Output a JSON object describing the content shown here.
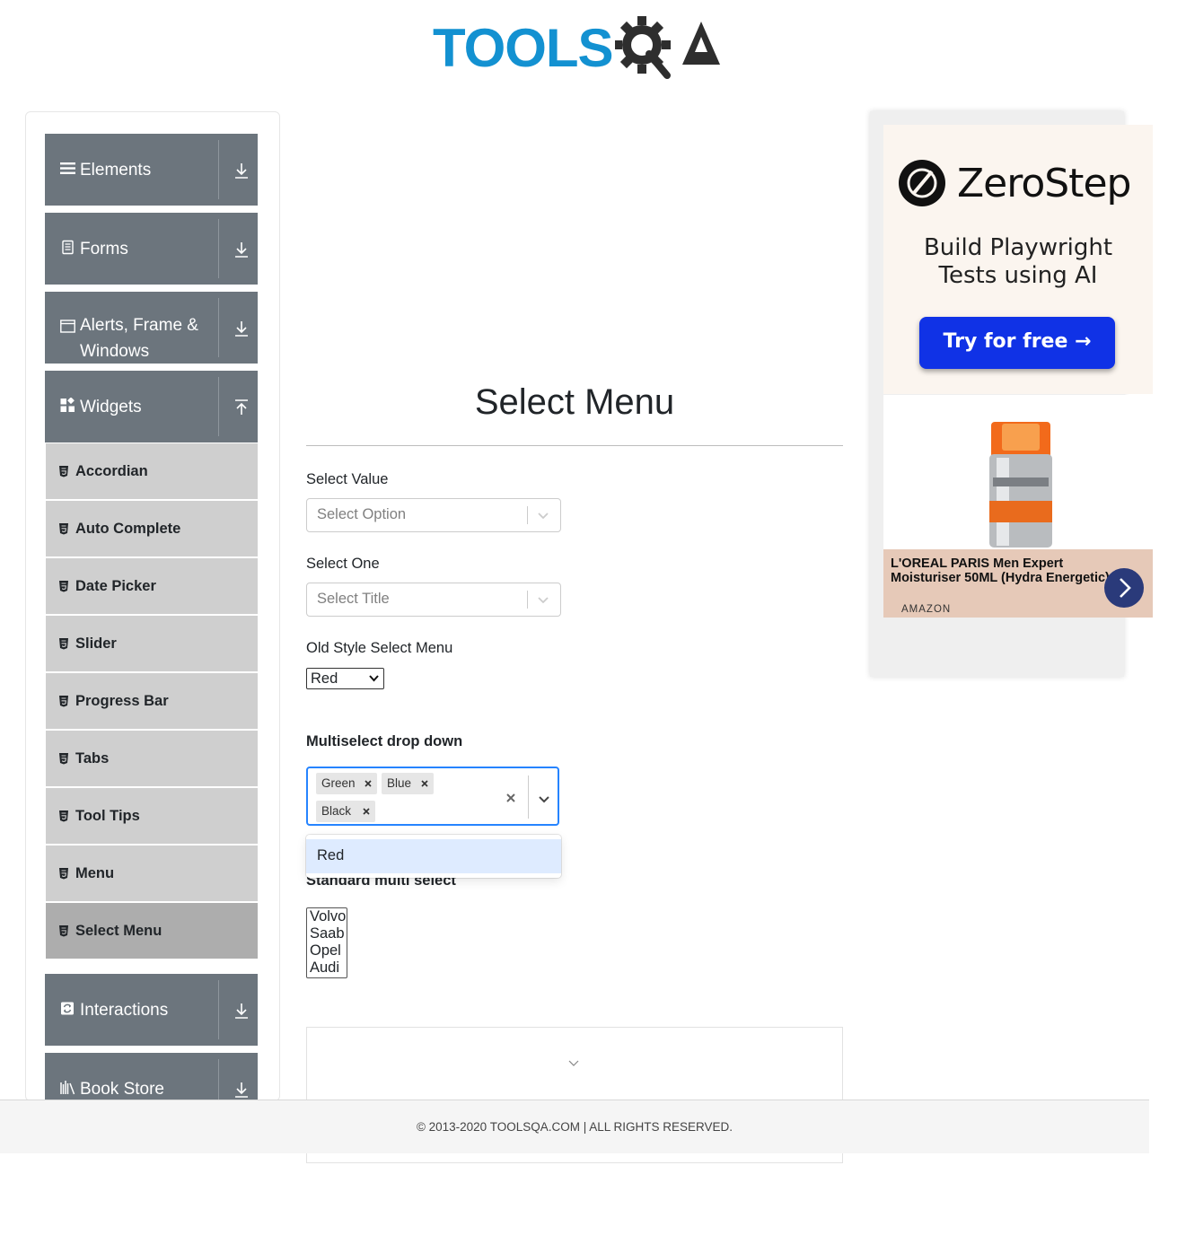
{
  "header": {
    "logo_text": "TOOLSQA",
    "logo_word": "TOOLS",
    "logo_suffix": "QA"
  },
  "sidebar": {
    "groups": [
      {
        "label": "Elements",
        "icon": "hamburger-icon",
        "expanded": false
      },
      {
        "label": "Forms",
        "icon": "document-icon",
        "expanded": false
      },
      {
        "label": "Alerts, Frame & Windows",
        "icon": "window-icon",
        "expanded": false
      },
      {
        "label": "Widgets",
        "icon": "widgets-icon",
        "expanded": true
      },
      {
        "label": "Interactions",
        "icon": "interactions-icon",
        "expanded": false
      },
      {
        "label": "Book Store",
        "icon": "books-icon",
        "expanded": false
      }
    ],
    "widget_items": [
      {
        "label": "Accordian"
      },
      {
        "label": "Auto Complete"
      },
      {
        "label": "Date Picker"
      },
      {
        "label": "Slider"
      },
      {
        "label": "Progress Bar"
      },
      {
        "label": "Tabs"
      },
      {
        "label": "Tool Tips"
      },
      {
        "label": "Menu"
      },
      {
        "label": "Select Menu",
        "active": true
      }
    ]
  },
  "main": {
    "title": "Select Menu",
    "select_value": {
      "label": "Select Value",
      "placeholder": "Select Option"
    },
    "select_one": {
      "label": "Select One",
      "placeholder": "Select Title"
    },
    "old_style": {
      "label": "Old Style Select Menu",
      "value": "Red"
    },
    "multiselect": {
      "label": "Multiselect drop down",
      "chips": [
        "Green",
        "Blue",
        "Black"
      ],
      "menu_options": [
        "Red"
      ]
    },
    "standard_multi": {
      "label": "Standard multi select",
      "options": [
        "Volvo",
        "Saab",
        "Opel",
        "Audi"
      ]
    }
  },
  "footer": {
    "text": "© 2013-2020 TOOLSQA.COM | ALL RIGHTS RESERVED."
  },
  "ad": {
    "brand": "ZeroStep",
    "tagline_1": "Build Playwright",
    "tagline_2": "Tests using AI",
    "cta": "Try for free →",
    "product_title": "L'OREAL PARIS Men Expert Moisturiser 50ML (Hydra Energetic)",
    "store": "AMAZON"
  },
  "colors": {
    "brand_blue": "#1391d1",
    "sidebar_group": "#6c757d",
    "sidebar_item": "#cfcfcf",
    "sidebar_item_active": "#adadad",
    "focus_blue": "#2684ff",
    "option_highlight": "#deebff"
  }
}
